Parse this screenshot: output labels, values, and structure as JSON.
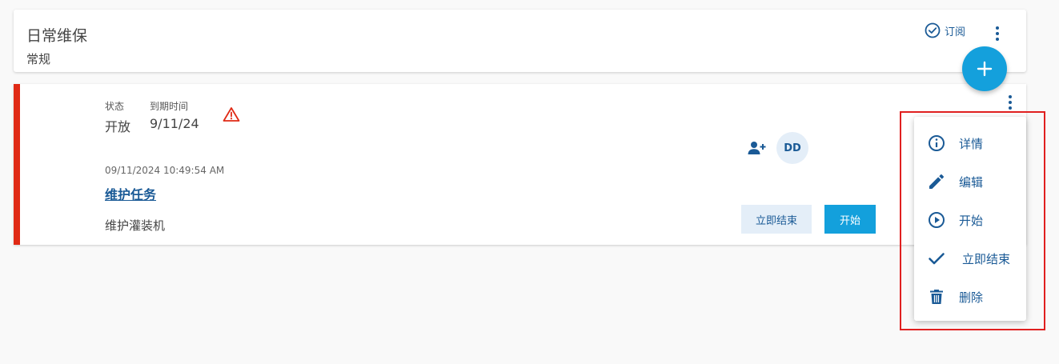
{
  "header": {
    "title": "日常维保",
    "subtitle": "常规",
    "subscribe_label": "订阅"
  },
  "task": {
    "status_label": "状态",
    "status_value": "开放",
    "due_label": "到期时间",
    "due_value": "9/11/24",
    "avatar_initials": "DD",
    "timestamp": "09/11/2024 10:49:54 AM",
    "title": "维护任务",
    "description": "维护灌装机",
    "finish_now_label": "立即结束",
    "start_label": "开始"
  },
  "menu": {
    "items": [
      {
        "label": "详情",
        "icon": "info-icon"
      },
      {
        "label": "编辑",
        "icon": "pencil-icon"
      },
      {
        "label": "开始",
        "icon": "play-icon"
      },
      {
        "label": "立即结束",
        "icon": "check-icon"
      },
      {
        "label": "删除",
        "icon": "trash-icon"
      }
    ]
  },
  "colors": {
    "accent": "#13a0dc",
    "link": "#1a5a96",
    "alert": "#e02a15"
  }
}
